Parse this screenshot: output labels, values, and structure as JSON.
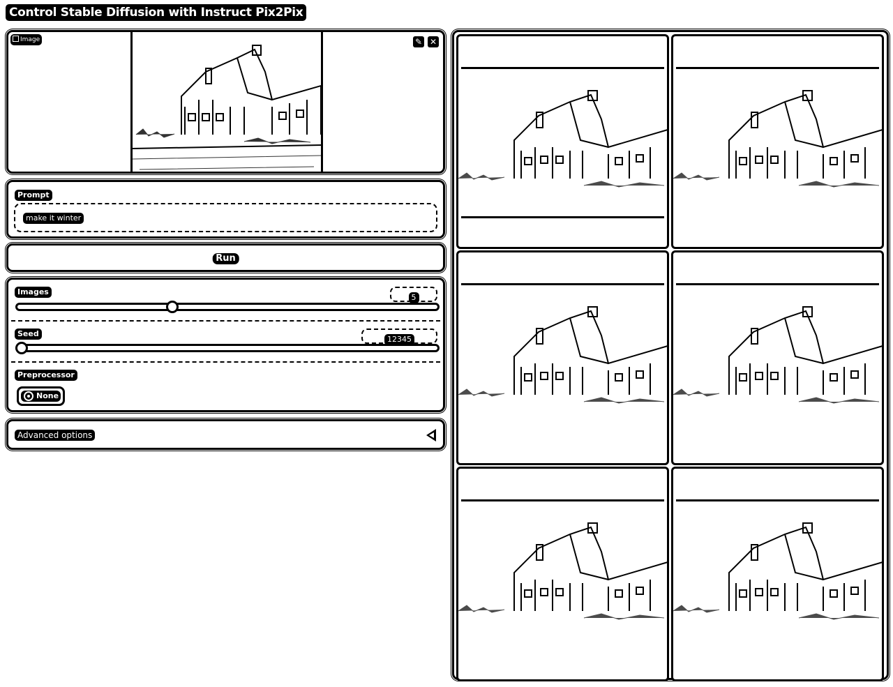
{
  "app": {
    "title": "Control Stable Diffusion with Instruct Pix2Pix"
  },
  "image_input": {
    "label": "Image",
    "icon": "image-icon",
    "edit_icon": "pencil-icon",
    "close_icon": "close-icon"
  },
  "prompt": {
    "label": "Prompt",
    "value": "make it winter"
  },
  "run": {
    "label": "Run"
  },
  "images_slider": {
    "label": "Images",
    "value": "5",
    "fraction": 0.37
  },
  "seed_slider": {
    "label": "Seed",
    "value": "12345",
    "fraction": 0.0
  },
  "preprocessor": {
    "label": "Preprocessor",
    "options": [
      "None"
    ],
    "selected": "None"
  },
  "advanced": {
    "label": "Advanced options",
    "icon": "caret-left-icon"
  },
  "gallery": {
    "count": 6
  }
}
